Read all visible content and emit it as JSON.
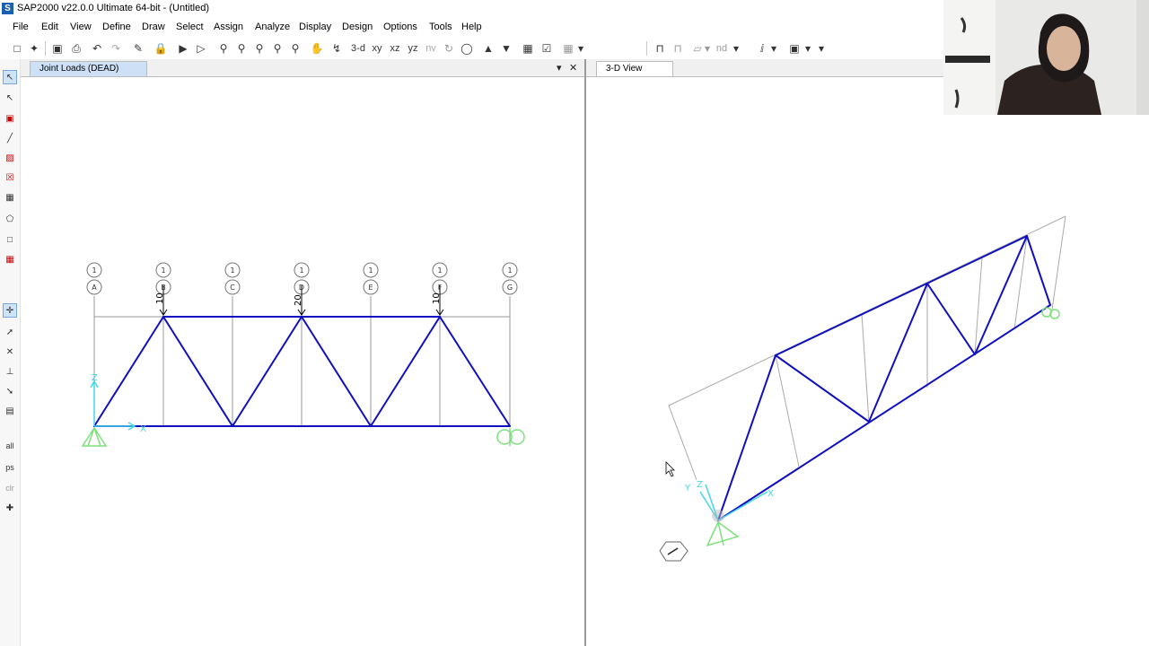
{
  "window": {
    "title": "SAP2000 v22.0.0 Ultimate 64-bit - (Untitled)",
    "app_icon": "S"
  },
  "menu": [
    "File",
    "Edit",
    "View",
    "Define",
    "Draw",
    "Select",
    "Assign",
    "Analyze",
    "Display",
    "Design",
    "Options",
    "Tools",
    "Help"
  ],
  "toolbar": {
    "view_labels": {
      "view_3d": "3-d",
      "view_xy": "xy",
      "view_xz": "xz",
      "view_yz": "yz",
      "view_nv": "nv",
      "nd": "nd"
    }
  },
  "left_tools": {
    "all_label": "all",
    "ps_label": "ps",
    "clr_label": "clr"
  },
  "panes": {
    "left": {
      "tab_title": "Joint Loads (DEAD)"
    },
    "right": {
      "tab_title": "3-D View"
    }
  },
  "truss_2d": {
    "grid_bubbles_top": [
      "1",
      "1",
      "1",
      "1",
      "1",
      "1",
      "1"
    ],
    "grid_bubbles_bottom": [
      "A",
      "B",
      "C",
      "D",
      "E",
      "F",
      "G"
    ],
    "load_labels": [
      "10",
      "20",
      "10"
    ],
    "axis_labels": {
      "z": "Z",
      "x": "X"
    }
  },
  "view_3d": {
    "axis_labels": {
      "x": "X",
      "y": "Y",
      "z": "Z"
    }
  },
  "colors": {
    "member": "#1010c0",
    "grid": "#9a9a9a",
    "support": "#7de07d",
    "axis": "#40d8e8",
    "load": "#000000"
  }
}
